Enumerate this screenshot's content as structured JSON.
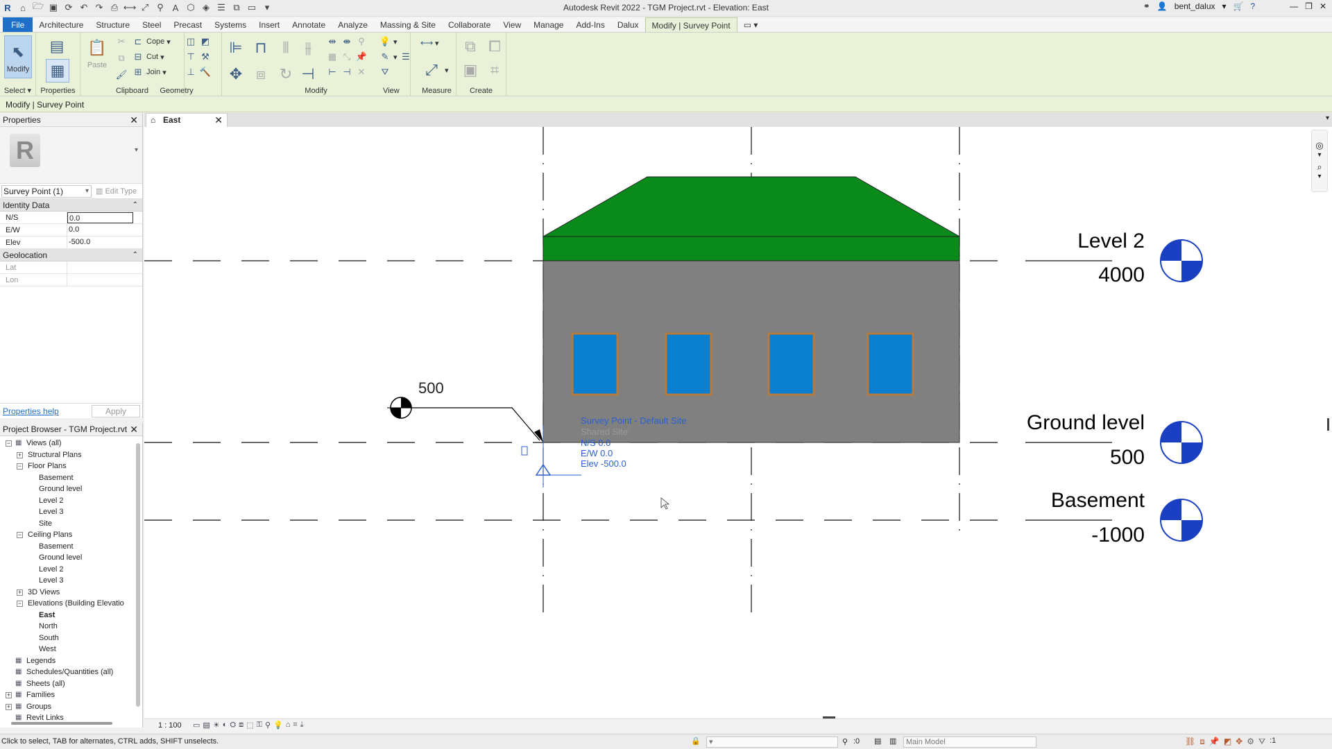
{
  "app": {
    "title": "Autodesk Revit 2022 - TGM Project.rvt - Elevation: East",
    "user": "bent_dalux"
  },
  "menubar": {
    "tabs": [
      "File",
      "Architecture",
      "Structure",
      "Steel",
      "Precast",
      "Systems",
      "Insert",
      "Annotate",
      "Analyze",
      "Massing & Site",
      "Collaborate",
      "View",
      "Manage",
      "Add-Ins",
      "Dalux",
      "Modify | Survey Point"
    ]
  },
  "ribbon": {
    "select_label": "Select",
    "modify_label": "Modify",
    "properties_label": "Properties",
    "paste_label": "Paste",
    "clipboard_label": "Clipboard",
    "cope_label": "Cope",
    "cut_label": "Cut",
    "join_label": "Join",
    "geometry_label": "Geometry",
    "modify_panel_label": "Modify",
    "view_label": "View",
    "measure_label": "Measure",
    "create_label": "Create"
  },
  "options_bar": {
    "context": "Modify | Survey Point"
  },
  "properties": {
    "header": "Properties",
    "type_selector": "Survey Point (1)",
    "edit_type": "Edit Type",
    "groups": {
      "identity": "Identity Data",
      "geolocation": "Geolocation"
    },
    "rows": {
      "ns": {
        "key": "N/S",
        "value": "0.0"
      },
      "ew": {
        "key": "E/W",
        "value": "0.0"
      },
      "elev": {
        "key": "Elev",
        "value": "-500.0"
      },
      "lat": {
        "key": "Lat",
        "value": ""
      },
      "lon": {
        "key": "Lon",
        "value": ""
      }
    },
    "help_link": "Properties help",
    "apply": "Apply"
  },
  "project_browser": {
    "header": "Project Browser - TGM Project.rvt",
    "nodes": [
      {
        "label": "Views (all)",
        "level": 0,
        "toggle": "−"
      },
      {
        "label": "Structural Plans",
        "level": 1,
        "toggle": "+"
      },
      {
        "label": "Floor Plans",
        "level": 1,
        "toggle": "−"
      },
      {
        "label": "Basement",
        "level": 2,
        "toggle": ""
      },
      {
        "label": "Ground level",
        "level": 2,
        "toggle": ""
      },
      {
        "label": "Level 2",
        "level": 2,
        "toggle": ""
      },
      {
        "label": "Level 3",
        "level": 2,
        "toggle": ""
      },
      {
        "label": "Site",
        "level": 2,
        "toggle": ""
      },
      {
        "label": "Ceiling Plans",
        "level": 1,
        "toggle": "−"
      },
      {
        "label": "Basement",
        "level": 2,
        "toggle": ""
      },
      {
        "label": "Ground level",
        "level": 2,
        "toggle": ""
      },
      {
        "label": "Level 2",
        "level": 2,
        "toggle": ""
      },
      {
        "label": "Level 3",
        "level": 2,
        "toggle": ""
      },
      {
        "label": "3D Views",
        "level": 1,
        "toggle": "+"
      },
      {
        "label": "Elevations (Building Elevatio",
        "level": 1,
        "toggle": "−"
      },
      {
        "label": "East",
        "level": 2,
        "toggle": "",
        "bold": true
      },
      {
        "label": "North",
        "level": 2,
        "toggle": ""
      },
      {
        "label": "South",
        "level": 2,
        "toggle": ""
      },
      {
        "label": "West",
        "level": 2,
        "toggle": ""
      },
      {
        "label": "Legends",
        "level": 0,
        "toggle": ""
      },
      {
        "label": "Schedules/Quantities (all)",
        "level": 0,
        "toggle": ""
      },
      {
        "label": "Sheets (all)",
        "level": 0,
        "toggle": ""
      },
      {
        "label": "Families",
        "level": 0,
        "toggle": "+"
      },
      {
        "label": "Groups",
        "level": 0,
        "toggle": "+"
      },
      {
        "label": "Revit Links",
        "level": 0,
        "toggle": ""
      }
    ]
  },
  "view_tab": {
    "label": "East"
  },
  "drawing": {
    "levels": [
      {
        "name": "Level 2",
        "elevation": "4000"
      },
      {
        "name": "Ground level",
        "elevation": "500"
      },
      {
        "name": "Basement",
        "elevation": "-1000"
      }
    ],
    "spot_elevation": "500",
    "survey_point": {
      "title": "Survey Point - Default Site",
      "shared_site": "Shared Site:",
      "ns": "N/S   0.0",
      "ew": "E/W   0.0",
      "elev": "Elev   -500.0"
    },
    "colors": {
      "roof": "#0a8a1a",
      "wall": "#808080",
      "window": "#0a7fd0",
      "window_frame": "#b87a3a",
      "level_head": "#1a3fc0"
    }
  },
  "view_control_bar": {
    "scale": "1 : 100"
  },
  "status": {
    "message": "Click to select, TAB for alternates, CTRL adds, SHIFT unselects.",
    "selection_count": ":0",
    "model": "Main Model",
    "filter_count": ":1"
  }
}
